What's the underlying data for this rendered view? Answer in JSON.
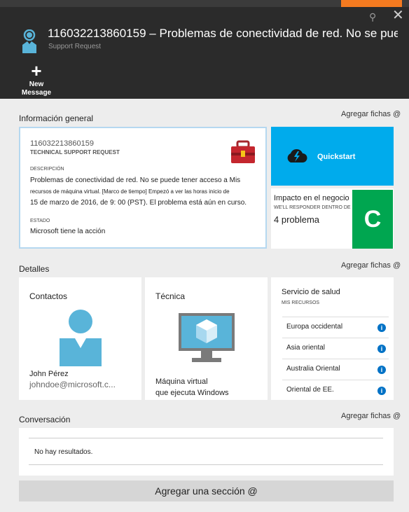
{
  "header": {
    "title_id": "116032213860159",
    "title_text": "Problemas de conectividad de red. No se puede acce...",
    "subtitle": "Support Request",
    "new_message_label_1": "New",
    "new_message_label_2": "Message"
  },
  "general": {
    "section_title": "Información general",
    "add_tiles": "Agregar fichas @",
    "request_id": "116032213860159",
    "request_type": "TECHNICAL SUPPORT REQUEST",
    "description_label": "DESCRIPCIÓN",
    "description_line1": "Problemas de conectividad de red. No se puede tener acceso a Mis",
    "description_line2": "recursos de máquina virtual. [Marco de tiempo] Empezó a ver las horas inicio de",
    "description_line3": "15 de marzo de 2016, de 9: 00 (PST). El problema está aún en curso.",
    "state_label": "ESTADO",
    "state_value": "Microsoft tiene la acción",
    "quickstart_label": "Quickstart",
    "impact_title": "Impacto en el negocio",
    "impact_respond": "WE'LL RESPONDER DENTRO DE",
    "impact_value": "4 problema",
    "impact_letter": "C"
  },
  "details": {
    "section_title": "Detalles",
    "add_tiles": "Agregar fichas @",
    "contacts_title": "Contactos",
    "contact_name": "John   Pérez",
    "contact_email": "johndoe@microsoft.c...",
    "tech_title": "Técnica",
    "tech_line1": "Máquina virtual",
    "tech_line2": "que ejecuta Windows",
    "health_title": "Servicio de salud",
    "health_sub": "MIS RECURSOS",
    "health_items": [
      "Europa occidental",
      "Asia oriental",
      "Australia Oriental",
      "Oriental de EE."
    ],
    "info_glyph": "i"
  },
  "conversation": {
    "section_title": "Conversación",
    "add_tiles": "Agregar fichas @",
    "empty_text": "No hay resultados."
  },
  "footer": {
    "add_section_label": "Agregar una sección @"
  },
  "glyphs": {
    "pin": "⚲",
    "close": "✕",
    "plus": "+"
  },
  "colors": {
    "header_bg": "#2b2b2b",
    "accent_orange": "#f47a20",
    "quickstart_blue": "#00abec",
    "impact_green": "#00a650",
    "contact_blue": "#59b4d9"
  }
}
